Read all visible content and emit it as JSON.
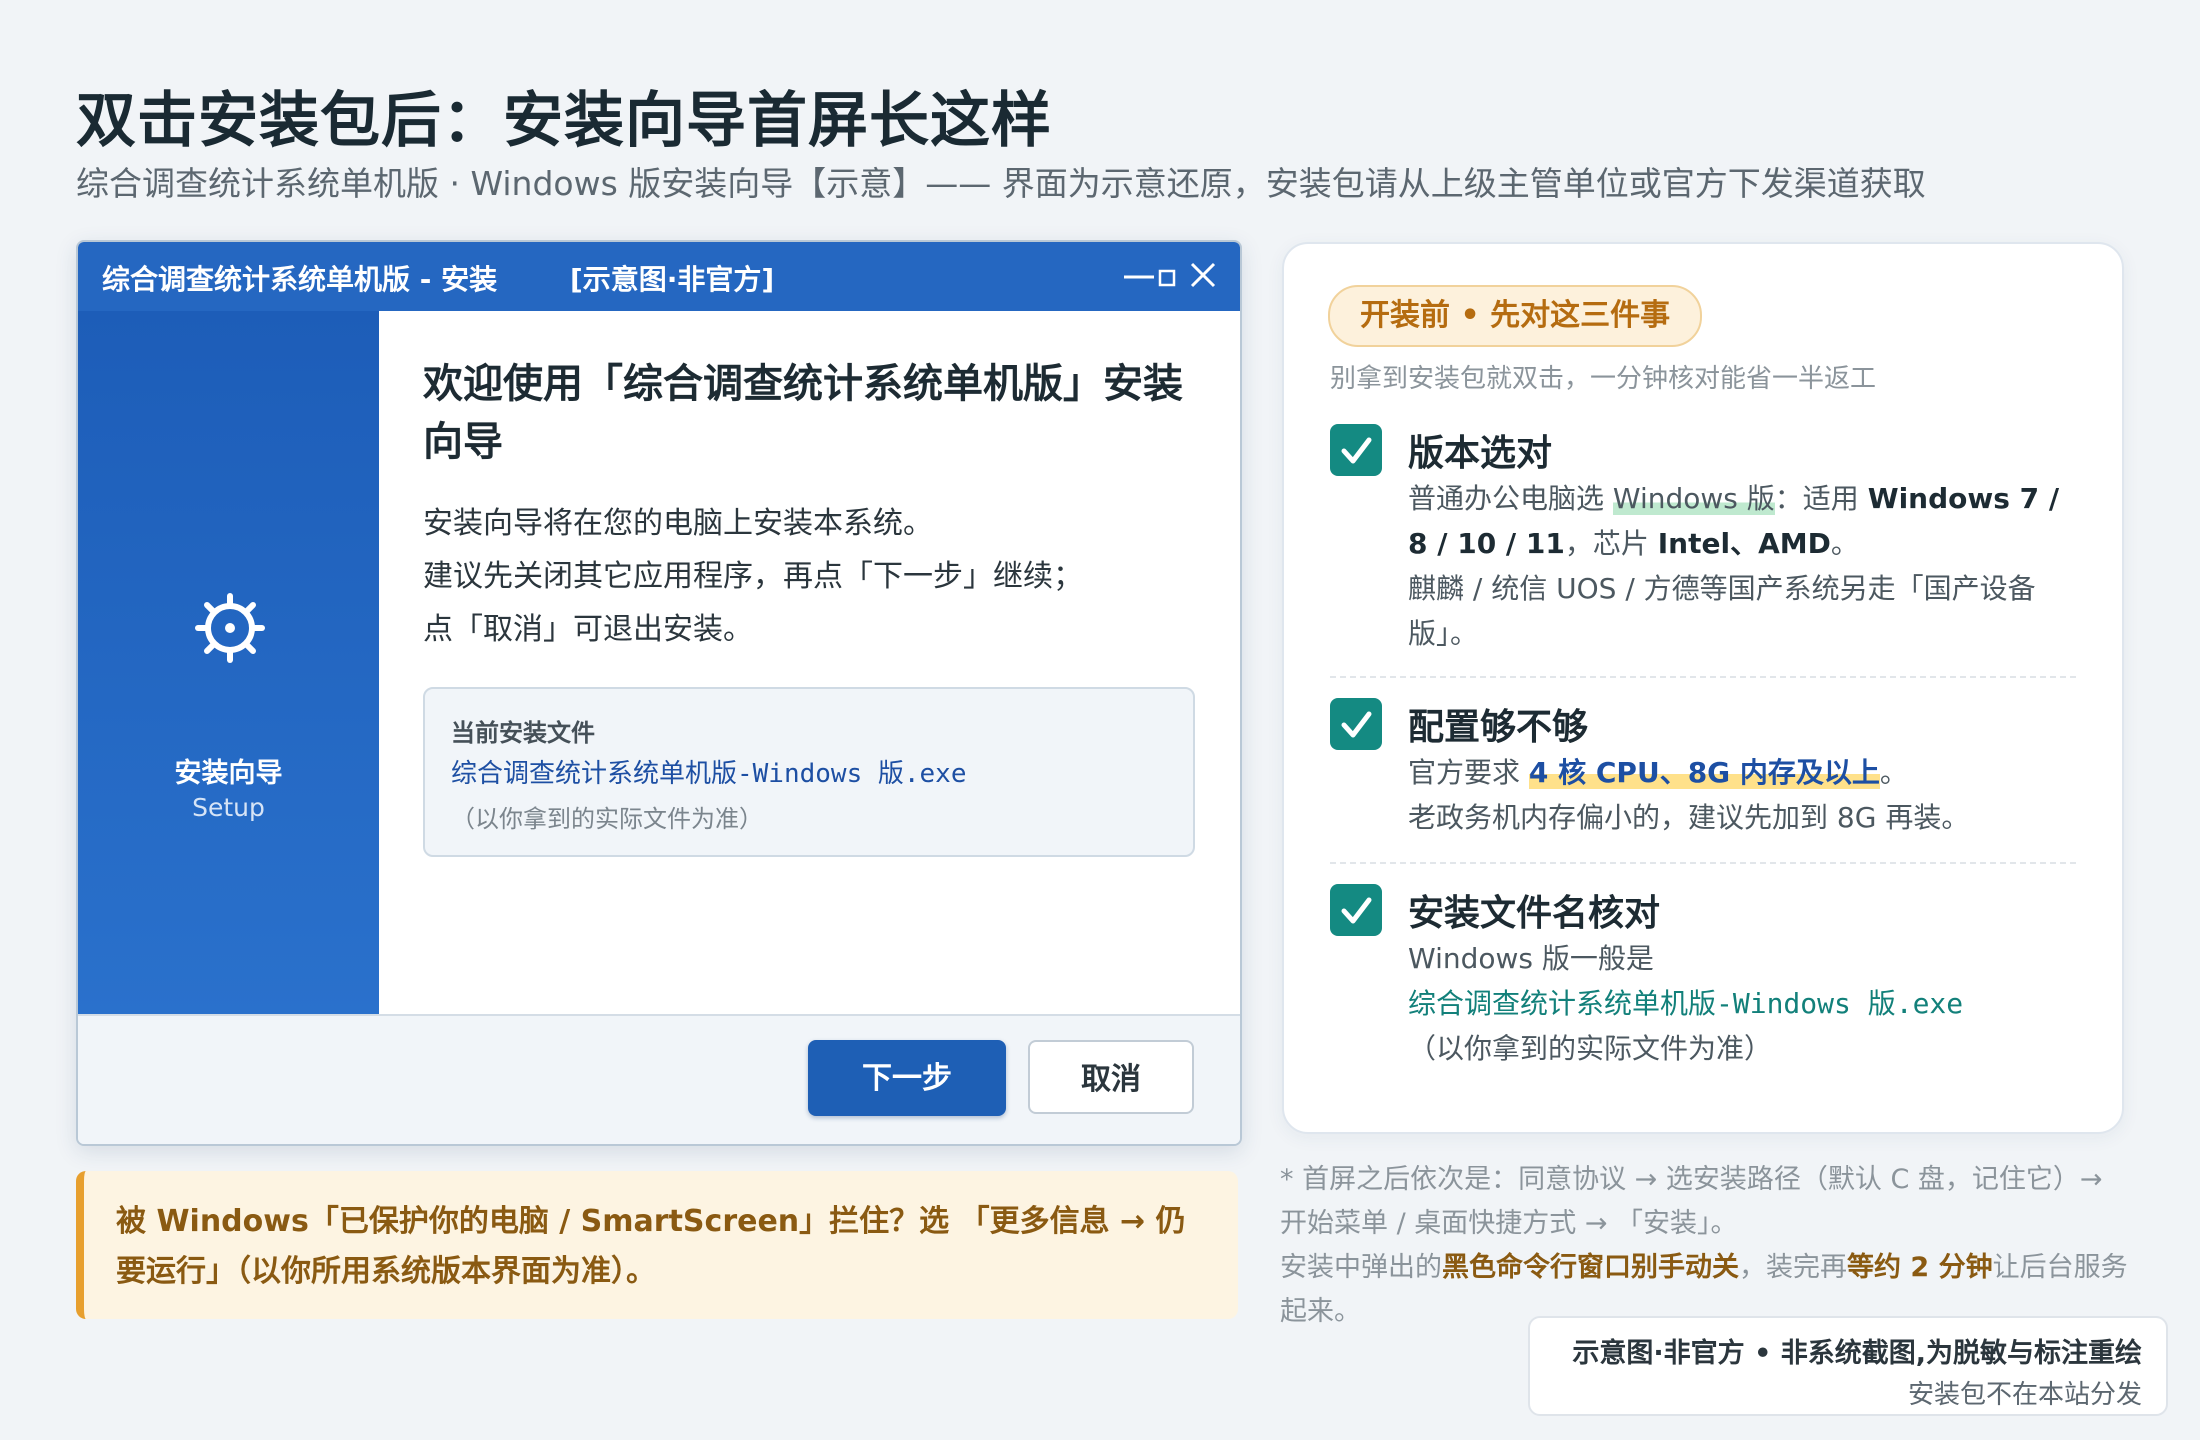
{
  "page": {
    "title": "双击安装包后：安装向导首屏长这样",
    "subtitle": "综合调查统计系统单机版 · Windows 版安装向导【示意】—— 界面为示意还原，安装包请从上级主管单位或官方下发渠道获取"
  },
  "installer": {
    "window_title": "综合调查统计系统单机版 - 安装",
    "window_tag": "[示意图·非官方]",
    "controls": [
      "minimize-icon",
      "maximize-icon",
      "close-icon"
    ],
    "side_icon": "gear-icon",
    "side_label": "安装向导",
    "side_sublabel": "Setup",
    "welcome_heading": "欢迎使用「综合调查统计系统单机版」安装向导",
    "intro_lines": [
      "安装向导将在您的电脑上安装本系统。",
      "建议先关闭其它应用程序，再点「下一步」继续；",
      "点「取消」可退出安装。"
    ],
    "file_box": {
      "label": "当前安装文件",
      "filename": "综合调查统计系统单机版-Windows 版.exe",
      "note": "（以你拿到的实际文件为准）"
    },
    "next_button": "下一步",
    "cancel_button": "取消",
    "accent_color": "#2567c1"
  },
  "warning": {
    "text": "被 Windows「已保护你的电脑 / SmartScreen」拦住？选 「更多信息 → 仍要运行」（以你所用系统版本界面为准）。"
  },
  "checklist": {
    "pill": "开装前 • 先对这三件事",
    "subtitle": "别拿到安装包就双击，一分钟核对能省一半返工",
    "items": [
      {
        "icon": "check-icon",
        "title": "版本选对",
        "line1_a": "普通办公电脑选 ",
        "line1_hl": "Windows 版",
        "line1_b": "：适用 ",
        "line1_bold": "Windows 7 / 8 / 10 / 11",
        "line1_c": "，芯片 ",
        "line1_bold2": "Intel、AMD",
        "line1_d": "。",
        "line2": "麒麟 / 统信 UOS / 方德等国产系统另走「国产设备版」。"
      },
      {
        "icon": "check-icon",
        "title": "配置够不够",
        "line1_a": "官方要求 ",
        "line1_hl": "4 核 CPU、8G 内存及以上",
        "line1_b": "。",
        "line2": "老政务机内存偏小的，建议先加到 8G 再装。"
      },
      {
        "icon": "check-icon",
        "title": "安装文件名核对",
        "line1": "Windows 版一般是",
        "filename": "综合调查统计系统单机版-Windows 版.exe",
        "note": "（以你拿到的实际文件为准）"
      }
    ]
  },
  "footnote": {
    "part1": "* 首屏之后依次是：同意协议 → 选安装路径（默认 C 盘，记住它）→ 开始菜单 / 桌面快捷方式 → 「安装」。",
    "part2a": "安装中弹出的",
    "part2_bold": "黑色命令行窗口别手动关",
    "part2b": "，装完再",
    "part2_bold2": "等约 2 分钟",
    "part2c": "让后台服务起来。"
  },
  "stamp": {
    "line1": "示意图·非官方 • 非系统截图,为脱敏与标注重绘",
    "line2": "安装包不在本站分发"
  }
}
